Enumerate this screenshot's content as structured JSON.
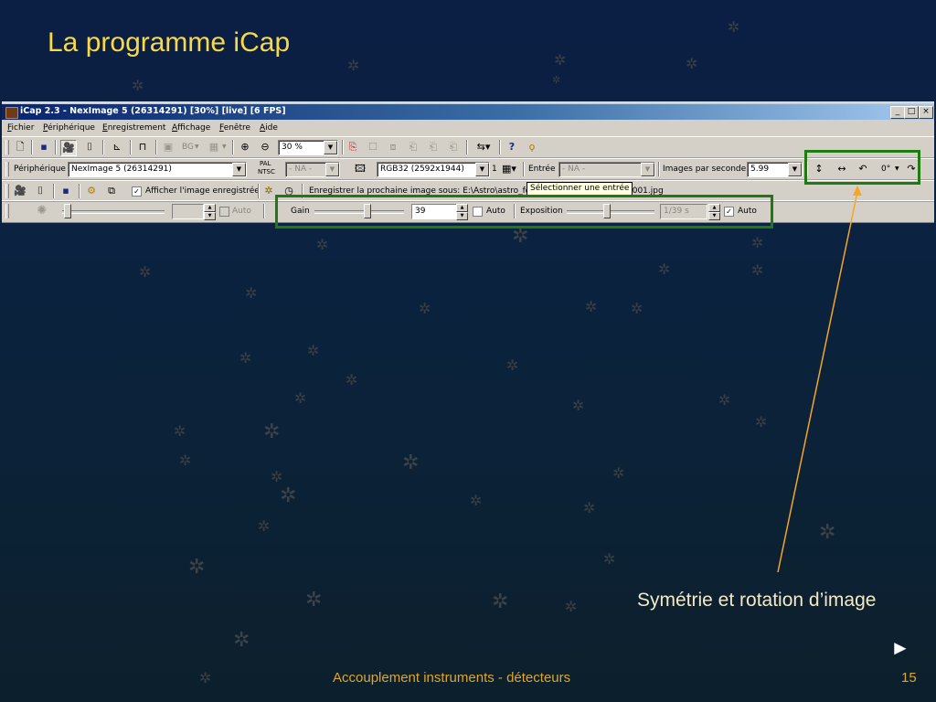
{
  "slide": {
    "title": "La programme iCap",
    "callout": "Symétrie et rotation d’image",
    "footer": "Accouplement instruments - détecteurs",
    "page_number": "15",
    "next_arrow": "►"
  },
  "colors": {
    "title": "#f7d94c",
    "footer": "#e0a52a",
    "highlight": "#1f7a12",
    "arrow": "#f5a623",
    "background": "#0b2240"
  },
  "window": {
    "title": "iCap 2.3 - NexImage 5 (26314291) [30%]  [live]  [6 FPS]",
    "minimize": "_",
    "maximize": "□",
    "close": "×"
  },
  "menu": {
    "fichier_u": "F",
    "fichier": "ichier",
    "peripherique_u": "P",
    "peripherique": "ériphérique",
    "enregistrement_u": "E",
    "enregistrement": "nregistrement",
    "affichage_u": "A",
    "affichage": "ffichage",
    "fenetre_u": "F",
    "fenetre": "enêtre",
    "aide_u": "A",
    "aide": "ide"
  },
  "toolbar1": {
    "bg_label": "BG",
    "zoom_value": "30 %"
  },
  "toolbar2": {
    "device_label": "Périphérique",
    "device_value": "NexImage 5 (26314291)",
    "pal_label": "PAL",
    "ntsc_label": "NTSC",
    "video_norm_value": "- NA -",
    "format_value": "RGB32 (2592x1944)",
    "binning_value": "1",
    "input_label": "Entrée",
    "input_value": "- NA -",
    "fps_label": "Images par seconde",
    "fps_value": "5.99",
    "rotation_value": "0°"
  },
  "toolbar3": {
    "show_saved_label": "Afficher l'image enregistrée",
    "show_saved_checked": "✓",
    "save_next_label": "Enregistrer la prochaine image sous: E:\\Astro\\astro_fc\\",
    "save_next_tail": "0001.jpg",
    "tooltip": "Sélectionner une entrée"
  },
  "toolbar4": {
    "brightness_auto_label": "Auto",
    "gain_label": "Gain",
    "gain_value": "39",
    "gain_auto_label": "Auto",
    "exposure_label": "Exposition",
    "exposure_value": "1/39 s",
    "exposure_auto_label": "Auto",
    "exposure_auto_checked": "✓"
  },
  "icons": {
    "new": "new-document-icon",
    "save": "save-icon",
    "live": "live-camera-icon",
    "snapshot": "snapshot-icon",
    "histogram": "histogram-icon",
    "trigger": "trigger-icon",
    "zoom_in": "zoom-in-icon",
    "zoom_out": "zoom-out-icon",
    "help": "help-icon",
    "flip_v": "flip-vertical-icon",
    "flip_h": "flip-horizontal-icon",
    "rotate_left": "rotate-left-icon",
    "rotate_right": "rotate-right-icon"
  },
  "glyphs": {
    "new": "🗋",
    "save": "▪",
    "live": "🎥",
    "snapshot": "⌷",
    "histogram": "⊾",
    "trigger": "⊓",
    "zoom_in": "⊕",
    "zoom_out": "⊖",
    "help_q": "?",
    "help_bulb": "ϙ",
    "flip_v": "↕",
    "flip_h": "↔",
    "rotate_left": "↶",
    "rotate_right": "↷",
    "brightness": "✺",
    "dropdown": "▼",
    "spin_up": "▲",
    "spin_down": "▼"
  }
}
